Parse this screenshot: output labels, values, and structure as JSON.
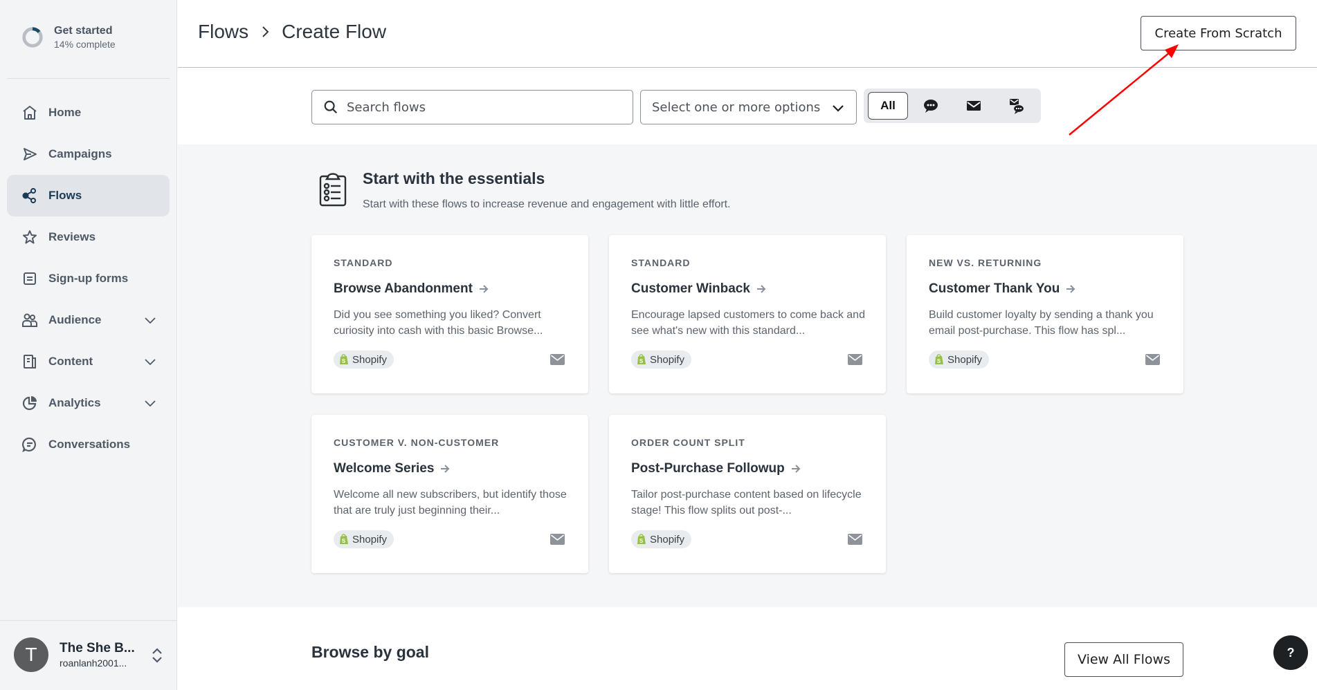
{
  "sidebar": {
    "get_started": {
      "title": "Get started",
      "subtitle": "14% complete",
      "progress_percent": 14
    },
    "items": [
      {
        "label": "Home",
        "icon": "home-icon",
        "active": false,
        "expandable": false
      },
      {
        "label": "Campaigns",
        "icon": "send-icon",
        "active": false,
        "expandable": false
      },
      {
        "label": "Flows",
        "icon": "flows-icon",
        "active": true,
        "expandable": false
      },
      {
        "label": "Reviews",
        "icon": "star-icon",
        "active": false,
        "expandable": false
      },
      {
        "label": "Sign-up forms",
        "icon": "form-icon",
        "active": false,
        "expandable": false
      },
      {
        "label": "Audience",
        "icon": "audience-icon",
        "active": false,
        "expandable": true
      },
      {
        "label": "Content",
        "icon": "content-icon",
        "active": false,
        "expandable": true
      },
      {
        "label": "Analytics",
        "icon": "analytics-icon",
        "active": false,
        "expandable": true
      },
      {
        "label": "Conversations",
        "icon": "conversations-icon",
        "active": false,
        "expandable": false
      }
    ],
    "account": {
      "initial": "T",
      "name": "The She B...",
      "email": "roanlanh2001..."
    }
  },
  "header": {
    "breadcrumb": [
      "Flows",
      "Create Flow"
    ],
    "create_button": "Create From Scratch"
  },
  "filters": {
    "search_placeholder": "Search flows",
    "select_placeholder": "Select one or more options",
    "channels": [
      {
        "label": "All",
        "icon": null,
        "active": true
      },
      {
        "label": "",
        "icon": "sms-icon",
        "active": false
      },
      {
        "label": "",
        "icon": "email-icon",
        "active": false
      },
      {
        "label": "",
        "icon": "email-sms-icon",
        "active": false
      }
    ]
  },
  "essentials": {
    "title": "Start with the essentials",
    "subtitle": "Start with these flows to increase revenue and engagement with little effort.",
    "cards": [
      {
        "tag": "STANDARD",
        "title": "Browse Abandonment",
        "description": "Did you see something you liked? Convert curiosity into cash with this basic Browse...",
        "integration": "Shopify",
        "channel": "email"
      },
      {
        "tag": "STANDARD",
        "title": "Customer Winback",
        "description": "Encourage lapsed customers to come back and see what's new with this standard...",
        "integration": "Shopify",
        "channel": "email"
      },
      {
        "tag": "NEW VS. RETURNING",
        "title": "Customer Thank You",
        "description": "Build customer loyalty by sending a thank you email post-purchase. This flow has spl...",
        "integration": "Shopify",
        "channel": "email"
      },
      {
        "tag": "CUSTOMER V. NON-CUSTOMER",
        "title": "Welcome Series",
        "description": "Welcome all new subscribers, but identify those that are truly just beginning their...",
        "integration": "Shopify",
        "channel": "email"
      },
      {
        "tag": "ORDER COUNT SPLIT",
        "title": "Post-Purchase Followup",
        "description": "Tailor post-purchase content based on lifecycle stage! This flow splits out post-...",
        "integration": "Shopify",
        "channel": "email"
      }
    ]
  },
  "browse": {
    "title": "Browse by goal",
    "view_all_button": "View All Flows"
  },
  "help_button": "?",
  "colors": {
    "annotation_arrow": "#ff0000",
    "active_nav_bg": "#e1e4e8",
    "progress_accent": "#1b4a66",
    "shopify_green": "#95bf47"
  }
}
